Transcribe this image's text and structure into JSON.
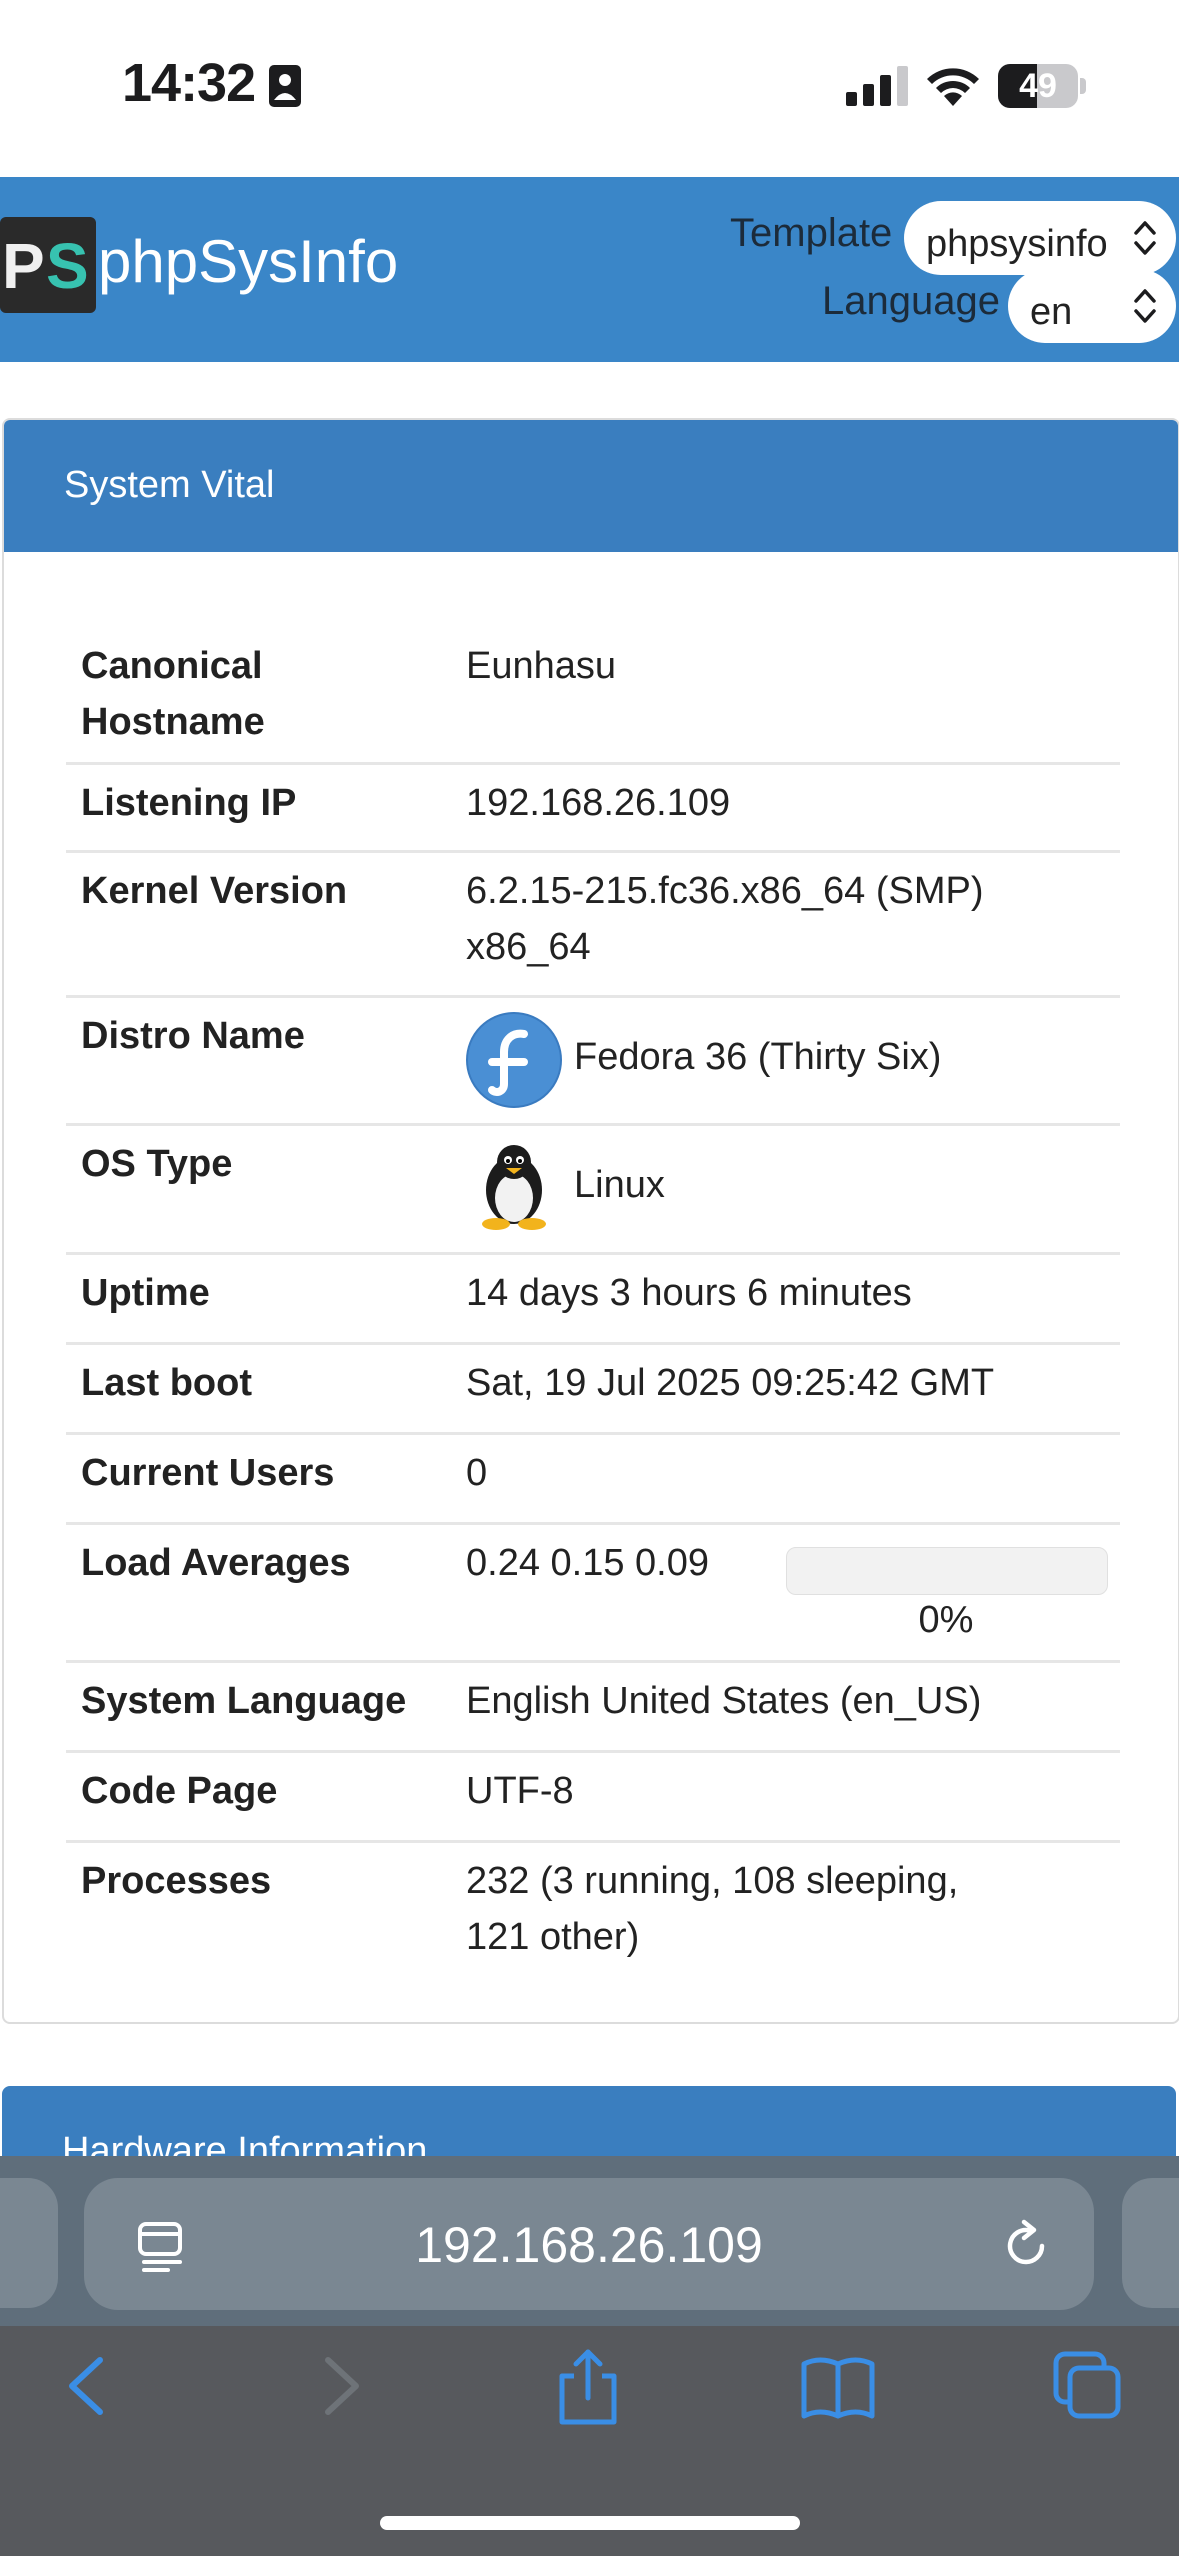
{
  "status_bar": {
    "time": "14:32",
    "battery": "49",
    "battery_level": 0.49
  },
  "header": {
    "logo_text_p": "P",
    "logo_text_s": "S",
    "brand": "phpSysInfo",
    "template_label": "Template",
    "template_value": "phpsysinfo",
    "language_label": "Language",
    "language_value": "en"
  },
  "system_vital": {
    "title": "System Vital",
    "rows": [
      {
        "label": "Canonical Hostname",
        "value": "Eunhasu"
      },
      {
        "label": "Listening IP",
        "value": "192.168.26.109"
      },
      {
        "label": "Kernel Version",
        "value": "6.2.15-215.fc36.x86_64 (SMP) x86_64"
      },
      {
        "label": "Distro Name",
        "value": "Fedora 36 (Thirty Six)",
        "icon": "fedora-logo-icon"
      },
      {
        "label": "OS Type",
        "value": "Linux",
        "icon": "tux-penguin-icon"
      },
      {
        "label": "Uptime",
        "value": "14 days 3 hours 6 minutes"
      },
      {
        "label": "Last boot",
        "value": "Sat, 19 Jul 2025 09:25:42 GMT"
      },
      {
        "label": "Current Users",
        "value": "0"
      },
      {
        "label": "Load Averages",
        "value": "0.24 0.15 0.09",
        "percent": "0%",
        "level": 0
      },
      {
        "label": "System Language",
        "value": "English United States (en_US)"
      },
      {
        "label": "Code Page",
        "value": "UTF-8"
      },
      {
        "label": "Processes",
        "value": "232 (3 running, 108 sleeping, 121 other)"
      }
    ]
  },
  "hardware_information": {
    "title": "Hardware Information"
  },
  "browser": {
    "url": "192.168.26.109"
  },
  "colors": {
    "header_bg": "#3a86c8",
    "panel_head_bg": "#3a7ebf",
    "toolbar_accent": "#3a8ee6"
  }
}
